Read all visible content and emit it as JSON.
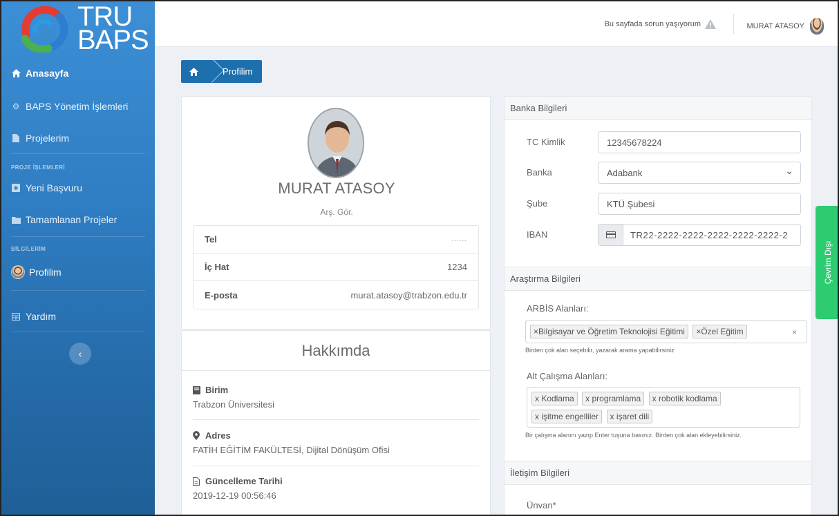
{
  "brand": {
    "line1": "TRU",
    "line2": "BAPS"
  },
  "sidebar": {
    "items": [
      {
        "label": "Anasayfa",
        "icon": "home-icon"
      },
      {
        "label": "BAPS Yönetim İşlemleri",
        "icon": "cogs-icon"
      },
      {
        "label": "Projelerim",
        "icon": "file-icon"
      },
      {
        "label": "Yeni Başvuru",
        "icon": "plus-square-icon"
      },
      {
        "label": "Tamamlanan Projeler",
        "icon": "folder-icon"
      },
      {
        "label": "Profilim",
        "icon": "avatar-icon"
      },
      {
        "label": "Yardım",
        "icon": "table-icon"
      }
    ],
    "headers": {
      "projects": "PROJE İŞLEMLERİ",
      "info": "BİLGİLERİM"
    }
  },
  "topbar": {
    "report": "Bu sayfada sorun yaşıyorum",
    "user": "MURAT ATASOY"
  },
  "breadcrumb": {
    "current": "Profilim"
  },
  "profile": {
    "name": "MURAT ATASOY",
    "title": "Arş. Gör.",
    "rows": [
      {
        "key": "Tel",
        "value": "......"
      },
      {
        "key": "İç Hat",
        "value": "1234"
      },
      {
        "key": "E-posta",
        "value": "murat.atasoy@trabzon.edu.tr"
      }
    ]
  },
  "about": {
    "heading": "Hakkımda",
    "items": [
      {
        "key": "Birim",
        "value": "Trabzon Üniversitesi"
      },
      {
        "key": "Adres",
        "value": "FATİH EĞİTİM FAKÜLTESİ, Dijital Dönüşüm Ofisi"
      },
      {
        "key": "Güncelleme Tarihi",
        "value": "2019-12-19 00:56:46"
      }
    ]
  },
  "bank": {
    "heading": "Banka Bilgileri",
    "tc_label": "TC Kimlik",
    "tc_value": "12345678224",
    "bank_label": "Banka",
    "bank_value": "Adabank",
    "branch_label": "Şube",
    "branch_value": "KTÜ Şubesi",
    "iban_label": "IBAN",
    "iban_value": "TR22-2222-2222-2222-2222-2222-2"
  },
  "research": {
    "heading": "Araştırma Bilgileri",
    "arbis_label": "ARBİS Alanları:",
    "arbis_tags": [
      "×Bilgisayar ve Öğretim Teknolojisi Eğitimi",
      "×Özel Eğitim"
    ],
    "arbis_hint": "Birden çok alan seçebilir, yazarak arama yapabilirsiniz",
    "sub_label": "Alt Çalışma Alanları:",
    "sub_tags": [
      "x Kodlama",
      "x programlama",
      "x robotik kodlama",
      "x işitme engelliler",
      "x işaret dili"
    ],
    "sub_hint": "Bir çalışma alanını yazıp Enter tuşuna basınız. Birden çok alan ekleyebilirsiniz."
  },
  "contact": {
    "heading": "İletişim Bilgileri",
    "title_label": "Ünvan*"
  },
  "offline": "Çevrim Dışı",
  "colors": {
    "sidebar": "#2f7dc2",
    "breadcrumb": "#1e6fae",
    "offline": "#2ecc71"
  }
}
